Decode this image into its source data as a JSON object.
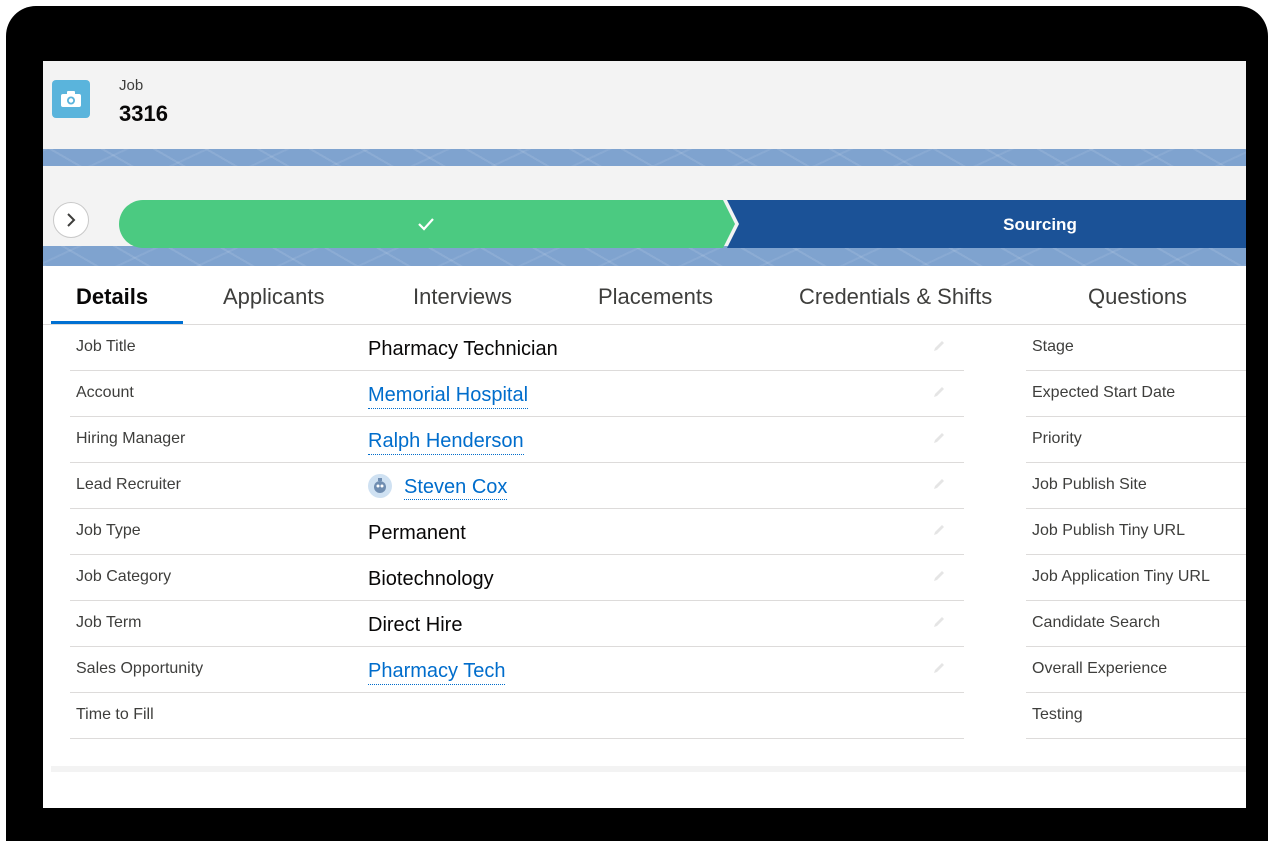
{
  "header": {
    "object_type": "Job",
    "record_name": "3316",
    "icon": "camera-icon"
  },
  "path": {
    "toggle_icon": "chevron-right-icon",
    "steps": [
      {
        "label": "",
        "state": "completed",
        "icon": "check-icon",
        "color": "#4bca81"
      },
      {
        "label": "Sourcing",
        "state": "current",
        "color": "#1b5297"
      }
    ]
  },
  "tabs": [
    "Details",
    "Applicants",
    "Interviews",
    "Placements",
    "Credentials & Shifts",
    "Questions"
  ],
  "active_tab": "Details",
  "left_fields": [
    {
      "label": "Job Title",
      "value": "Pharmacy Technician",
      "link": false
    },
    {
      "label": "Account",
      "value": "Memorial Hospital",
      "link": true
    },
    {
      "label": "Hiring Manager",
      "value": "Ralph Henderson",
      "link": true
    },
    {
      "label": "Lead Recruiter",
      "value": "Steven Cox",
      "link": true,
      "avatar": true
    },
    {
      "label": "Job Type",
      "value": "Permanent",
      "link": false
    },
    {
      "label": "Job Category",
      "value": "Biotechnology",
      "link": false
    },
    {
      "label": "Job Term",
      "value": "Direct Hire",
      "link": false
    },
    {
      "label": "Sales Opportunity",
      "value": "Pharmacy Tech",
      "link": true
    },
    {
      "label": "Time to Fill",
      "value": "",
      "link": false
    }
  ],
  "right_fields": [
    {
      "label": "Stage"
    },
    {
      "label": "Expected Start Date"
    },
    {
      "label": "Priority"
    },
    {
      "label": "Job Publish Site"
    },
    {
      "label": "Job Publish Tiny URL"
    },
    {
      "label": "Job Application Tiny URL"
    },
    {
      "label": "Candidate Search"
    },
    {
      "label": "Overall Experience"
    },
    {
      "label": "Testing"
    }
  ],
  "colors": {
    "accent": "#0070d2",
    "link": "#006dcc",
    "complete": "#4bca81",
    "current": "#1b5297",
    "icon_bg": "#5ab4dc"
  }
}
